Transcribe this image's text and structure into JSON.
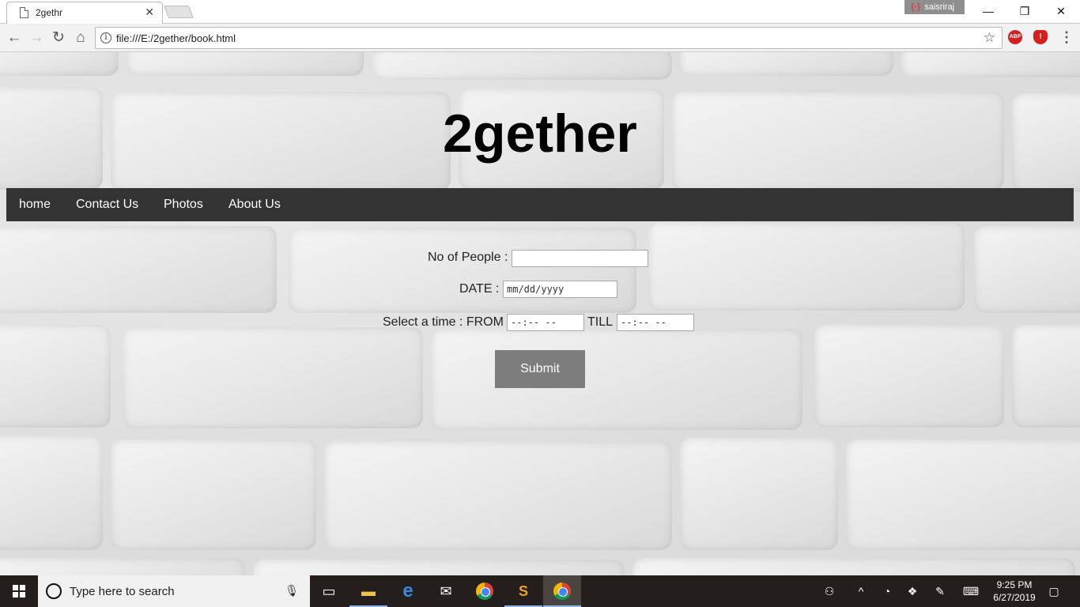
{
  "browser": {
    "tab_title": "2gethr",
    "tab_close": "✕",
    "profile_name": "saisriraj",
    "url": "file:///E:/2gether/book.html",
    "extensions": [
      "ABP",
      "!"
    ],
    "window_controls": {
      "minimize": "—",
      "restore": "❐",
      "close": "✕"
    },
    "nav": {
      "back": "←",
      "forward": "→",
      "reload": "↻",
      "home": "⌂",
      "bookmark": "☆",
      "menu": "⋮"
    }
  },
  "site": {
    "title": "2gether",
    "nav_items": [
      "home",
      "Contact Us",
      "Photos",
      "About Us"
    ]
  },
  "form": {
    "people_label": "No of People :",
    "people_value": "",
    "date_label": "DATE :",
    "date_placeholder": "mm/dd/yyyy",
    "time_label": "Select a time : FROM",
    "from_placeholder": "--:-- --",
    "till_label": "TILL",
    "till_placeholder": "--:-- --",
    "submit_label": "Submit"
  },
  "taskbar": {
    "search_placeholder": "Type here to search",
    "apps": [
      "task-view",
      "file-explorer",
      "edge",
      "mail",
      "chrome",
      "sublime-text",
      "chrome"
    ],
    "clock_time": "9:25 PM",
    "clock_date": "6/27/2019"
  },
  "colors": {
    "navbar": "#333333",
    "submit": "#7d7d7d",
    "taskbar": "#241e1c",
    "ext_red": "#d71f1f"
  }
}
